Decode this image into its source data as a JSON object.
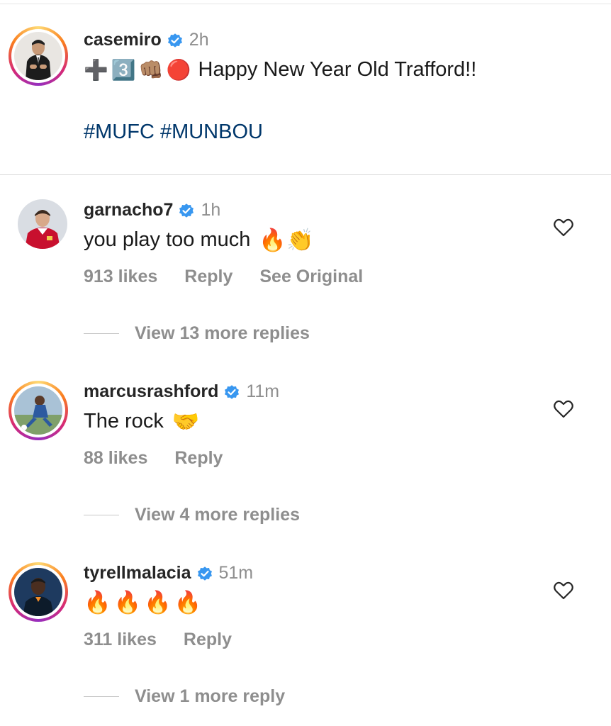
{
  "post": {
    "username": "casemiro",
    "time": "2h",
    "caption_emojis": [
      "➕",
      "3️⃣",
      "👊🏽",
      "🔴"
    ],
    "caption_text": "Happy New Year Old Trafford!!",
    "hashtags": "#MUFC #MUNBOU"
  },
  "comments": [
    {
      "username": "garnacho7",
      "time": "1h",
      "text": "you play too much",
      "emojis": "🔥👏",
      "likes": "913 likes",
      "reply": "Reply",
      "see_original": "See Original",
      "view_replies": "View 13 more replies"
    },
    {
      "username": "marcusrashford",
      "time": "11m",
      "text": "The rock",
      "emojis": "🤝",
      "likes": "88 likes",
      "reply": "Reply",
      "view_replies": "View 4 more replies"
    },
    {
      "username": "tyrellmalacia",
      "time": "51m",
      "text": "",
      "emojis": "🔥🔥🔥🔥",
      "likes": "311 likes",
      "reply": "Reply",
      "view_replies": "View 1 more reply"
    }
  ],
  "colors": {
    "verified": "#3897f0",
    "hashtag": "#00376b",
    "muted": "#8e8e8e"
  }
}
